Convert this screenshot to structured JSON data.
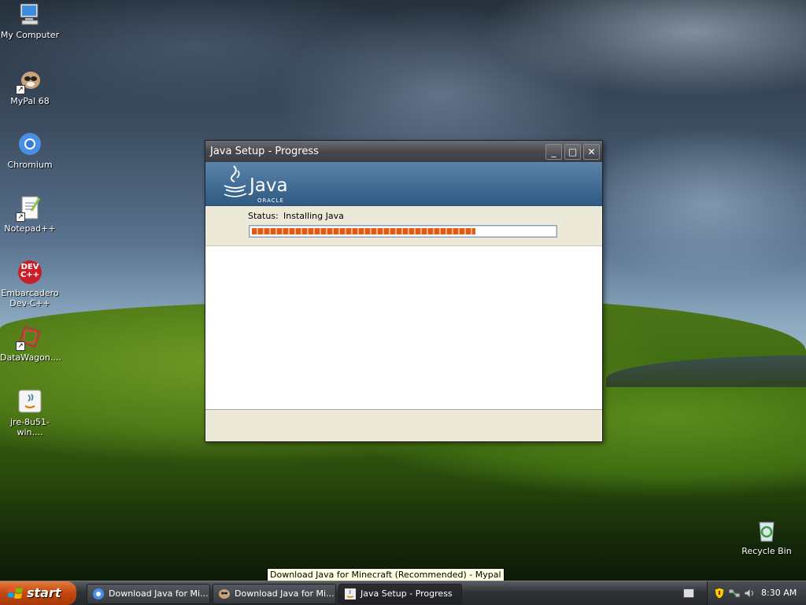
{
  "desktop": {
    "icons": [
      {
        "label": "My Computer"
      },
      {
        "label": "MyPal 68"
      },
      {
        "label": "Chromium"
      },
      {
        "label": "Notepad++"
      },
      {
        "label": "Embarcadero Dev-C++"
      },
      {
        "label": "DataWagon...."
      },
      {
        "label": "jre-8u51-win...."
      },
      {
        "label": "Recycle Bin"
      }
    ],
    "devcpp_badge": "DEV C++"
  },
  "window": {
    "title": "Java Setup - Progress",
    "logo_text": "Java",
    "logo_sub": "ORACLE",
    "status_label": "Status:",
    "status_value": "Installing Java",
    "progress_percent": 74,
    "controls": {
      "minimize": "_",
      "maximize": "□",
      "close": "✕"
    }
  },
  "taskbar": {
    "start_label": "start",
    "buttons": [
      {
        "label": "Download Java for Mi..."
      },
      {
        "label": "Download Java for Mi..."
      },
      {
        "label": "Java Setup - Progress"
      }
    ],
    "tooltip": "Download Java for Minecraft (Recommended) - Mypal",
    "clock": "8:30 AM"
  },
  "colors": {
    "progress_fill": "#e05a12",
    "banner": "#3f6a92",
    "start_button": "#c2470f"
  }
}
